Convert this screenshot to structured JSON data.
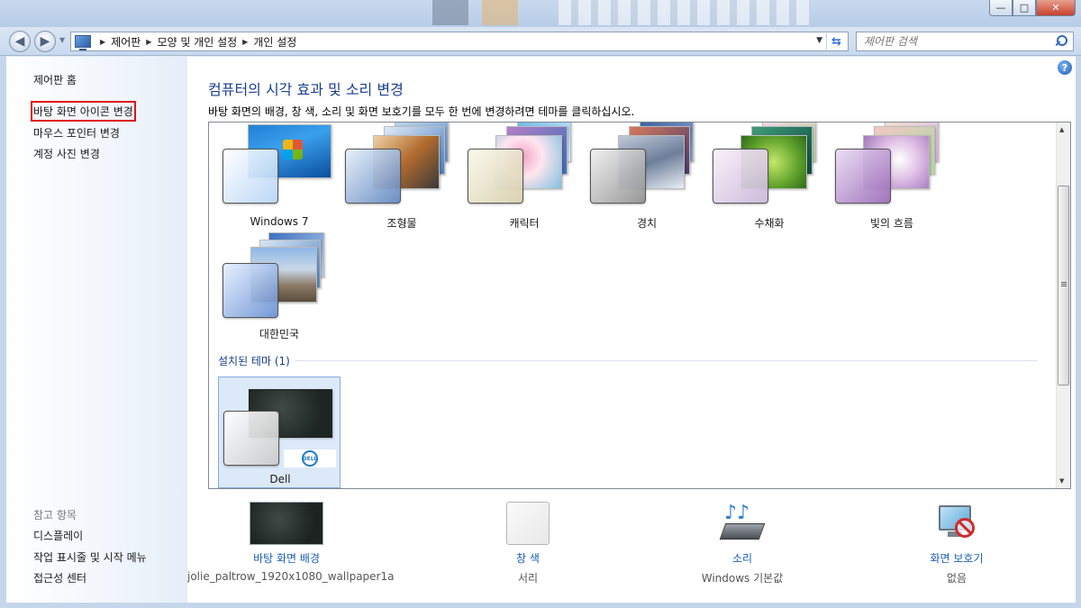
{
  "window": {
    "minimize_glyph": "—",
    "maximize_glyph": "□",
    "close_glyph": "✕"
  },
  "address": {
    "crumbs": [
      "제어판",
      "모양 및 개인 설정",
      "개인 설정"
    ],
    "search_placeholder": "제어판 검색"
  },
  "sidebar": {
    "home": "제어판 홈",
    "links": [
      "바탕 화면 아이콘 변경",
      "마우스 포인터 변경",
      "계정 사진 변경"
    ],
    "see_also_heading": "참고 항목",
    "see_also": [
      "디스플레이",
      "작업 표시줄 및 시작 메뉴",
      "접근성 센터"
    ]
  },
  "main": {
    "title": "컴퓨터의 시각 효과 및 소리 변경",
    "description": "바탕 화면의 배경, 창 색, 소리 및 화면 보호기를 모두 한 번에 변경하려면 테마를 클릭하십시오.",
    "aero_themes": [
      "Windows 7",
      "조형물",
      "캐릭터",
      "경치",
      "수채화",
      "빛의 흐름",
      "대한민국"
    ],
    "installed_group": "설치된 테마 (1)",
    "installed_themes": [
      "Dell"
    ],
    "selected_theme": "Dell"
  },
  "settings": {
    "background": {
      "label": "바탕 화면 배경",
      "value": "jolie_paltrow_1920x1080_wallpaper1a"
    },
    "color": {
      "label": "창 색",
      "value": "서리"
    },
    "sound": {
      "label": "소리",
      "value": "Windows 기본값"
    },
    "screensaver": {
      "label": "화면 보호기",
      "value": "없음"
    }
  },
  "colors": {
    "title_blue": "#1a3e8e",
    "link_blue": "#1a5fb4",
    "highlight_red": "#e01515",
    "selected_bg": "#dce9f8"
  }
}
